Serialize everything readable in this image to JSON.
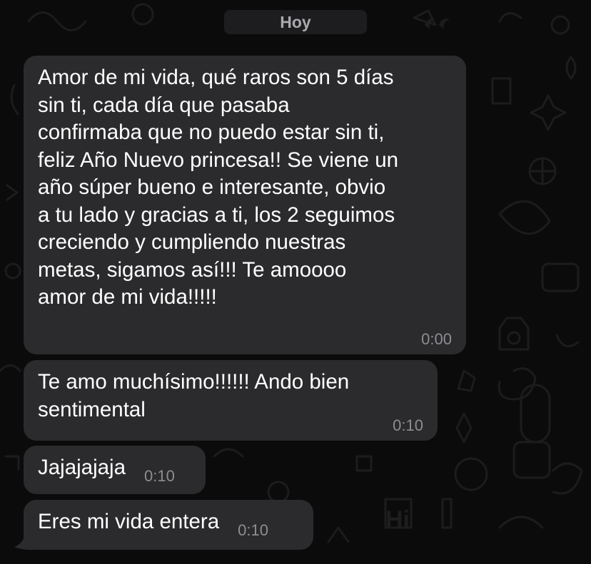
{
  "chat": {
    "date_label": "Hoy",
    "messages": [
      {
        "text": "Amor de mi vida, qué raros son 5 días\nsin ti, cada día que pasaba\nconfirmaba que no puedo estar sin ti,\nfeliz Año Nuevo princesa!! Se viene un\naño súper bueno e interesante, obvio\na tu lado y gracias a ti, los 2 seguimos\ncreciendo y cumpliendo nuestras\nmetas, sigamos así!!! Te amoooo\namor de mi vida!!!!!",
        "time": "0:00"
      },
      {
        "text": "Te amo muchísimo!!!!!! Ando bien\nsentimental",
        "time": "0:10"
      },
      {
        "text": "Jajajajaja",
        "time": "0:10"
      },
      {
        "text": "Eres mi vida entera",
        "time": "0:10"
      }
    ]
  },
  "colors": {
    "background": "#0b0b0b",
    "bubble": "#2b2b2d",
    "text": "#ffffff",
    "timestamp": "#8d8d92"
  }
}
